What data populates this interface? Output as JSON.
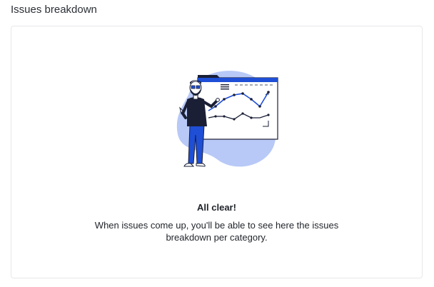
{
  "header": {
    "title": "Issues breakdown"
  },
  "empty_state": {
    "illustration": "presenter-with-line-chart-illustration",
    "title": "All clear!",
    "description": "When issues come up, you'll be able to see here the issues breakdown per category."
  },
  "colors": {
    "accent_blue": "#1f4fd6",
    "blob_blue": "#b8c9f7",
    "ink": "#1a1f36",
    "border": "#e6e8eb"
  }
}
